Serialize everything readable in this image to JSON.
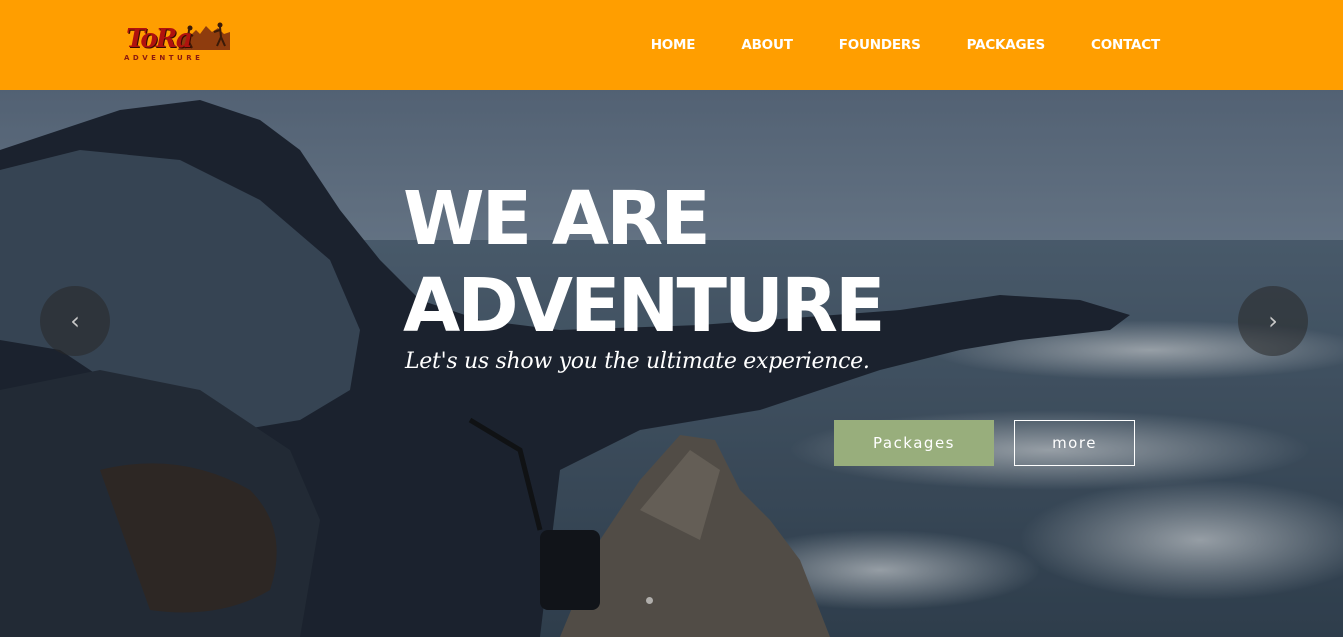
{
  "brand": {
    "logo_text": "ToRa",
    "logo_subtext": "ADVENTURE",
    "header_color": "#ff9e00"
  },
  "nav": {
    "items": [
      {
        "label": "HOME"
      },
      {
        "label": "ABOUT"
      },
      {
        "label": "FOUNDERS"
      },
      {
        "label": "PACKAGES"
      },
      {
        "label": "CONTACT"
      }
    ]
  },
  "hero": {
    "headline_line1": "WE ARE",
    "headline_line2": "ADVENTURE",
    "tagline": "Let's us show you the ultimate experience.",
    "primary_button": "Packages",
    "secondary_button": "more",
    "prev_icon": "‹",
    "next_icon": "›",
    "primary_button_color": "#98ae7c"
  }
}
